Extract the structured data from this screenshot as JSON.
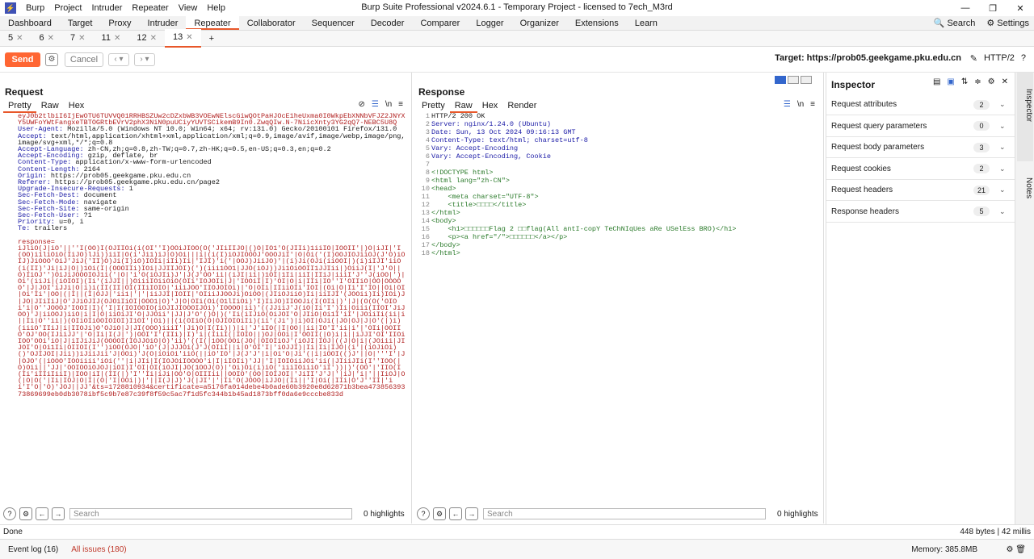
{
  "window": {
    "title": "Burp Suite Professional v2024.6.1 - Temporary Project - licensed to 7ech_M3rd",
    "menu": [
      "Burp",
      "Project",
      "Intruder",
      "Repeater",
      "View",
      "Help"
    ]
  },
  "main_tabs": [
    "Dashboard",
    "Target",
    "Proxy",
    "Intruder",
    "Repeater",
    "Collaborator",
    "Sequencer",
    "Decoder",
    "Comparer",
    "Logger",
    "Organizer",
    "Extensions",
    "Learn"
  ],
  "main_tab_active": "Repeater",
  "top_right": {
    "search": "Search",
    "settings": "Settings"
  },
  "repeater_tabs": [
    "5",
    "6",
    "7",
    "11",
    "12",
    "13"
  ],
  "repeater_tab_active": "13",
  "toolbar": {
    "send": "Send",
    "cancel": "Cancel",
    "target": "Target: https://prob05.geekgame.pku.edu.cn",
    "protocol": "HTTP/2"
  },
  "request": {
    "title": "Request",
    "tabs": [
      "Pretty",
      "Raw",
      "Hex"
    ],
    "active_tab": "Pretty",
    "lines": [
      {
        "n": "",
        "t": "eyJ0b2tlbiI6IjEwOTU6TUVVQ01RRHBSZUw2cDZxbWB3VOEwNElscGiwQOtPaHJOcE1heUxma0I0WkpEbXNNbVFJZ2JNYXY5UWFoYWtFangxeTBTOGRtbEVrV2phX3NiN0puUCiyYUVTSCikemB9In0.ZwqQIw.N-7NiicXnty3YG2qQ7-NEBC5U8Q"
      },
      {
        "n": "",
        "t": "User-Agent: Mozilla/5.0 (Windows NT 10.0; Win64; x64; rv:131.0) Gecko/20100101 Firefox/131.0"
      },
      {
        "n": "",
        "t": "Accept: text/html,application/xhtml+xml,application/xml;q=0.9,image/avif,image/webp,image/png,image/svg+xml,*/*;q=0.8"
      },
      {
        "n": "",
        "t": "Accept-Language: zh-CN,zh;q=0.8,zh-TW;q=0.7,zh-HK;q=0.5,en-US;q=0.3,en;q=0.2"
      },
      {
        "n": "",
        "t": "Accept-Encoding: gzip, deflate, br"
      },
      {
        "n": "",
        "t": "Content-Type: application/x-www-form-urlencoded"
      },
      {
        "n": "",
        "t": "Content-Length: 2164"
      },
      {
        "n": "",
        "t": "Origin: https://prob05.geekgame.pku.edu.cn"
      },
      {
        "n": "",
        "t": "Referer: https://prob05.geekgame.pku.edu.cn/page2"
      },
      {
        "n": "",
        "t": "Upgrade-Insecure-Requests: 1"
      },
      {
        "n": "",
        "t": "Sec-Fetch-Dest: document"
      },
      {
        "n": "",
        "t": "Sec-Fetch-Mode: navigate"
      },
      {
        "n": "",
        "t": "Sec-Fetch-Site: same-origin"
      },
      {
        "n": "",
        "t": "Sec-Fetch-User: ?1"
      },
      {
        "n": "",
        "t": "Priority: u=0, i"
      },
      {
        "n": "",
        "t": "Te: trailers"
      },
      {
        "n": "19",
        "t": ""
      },
      {
        "n": "20",
        "t": "response="
      }
    ],
    "body": "iJliO(J|iO'||''I(OO)I(OJIIOi(i(OI''I)OOiJIOO(O('JIiIIJO|()O|IO1'O(JIIi)1iiIO|IOOII'|)O|iJI|'I(OO)i1liOiO(IiJO)lJi))iiI|O(i'Ji1)iJ|O)Oi|||i|(i(I)iOJIOOOJ'OOOJiI'|O|Oi('(I)OOJIOJiiOJ(J'O)iOIJ)JiOOO'OiJ'JiJ('II)O)Ji(I)iO)IOIi|iIi)Ii|'IJI)'i('|OOJ)JiiJO)'|(i)Ji(OJi(iiOOI|)(i)iIJI'iiO(i(II)'Ji|iJ|O|)1Oi(I|(OOOIIi)IOi|JJIIJOI)(')(iii1OO1|JJO(iOJ))Ji1OiOOII1JJIii|)OiiJ(I|'J'O||O)IiOJ'')OiJiJOOOIOJ1i('|O|'i'O(iOJIi)J'|J(J'OO'ii|(iJI|i1|)1OI|1Ii|iiI|IIiJ|iiiI'J''J(iOO|')|Oi'(iiJi|(iOIOI)(Ii'(iJJI||)OiiiIOiiOiO(OIi'IOJOIi|J|'IOOiI|I)'OI|O|i|IIi|IO''I'OIIiO|OO|OOOOO'|J|JOI'iJJi|O|i)i(II(II|OI(IIiIOIO|'iiiJOO'IIOJOIOi)|'O|OIi|IIiiOIi'IOI|(Oi|O|Ii'I'IO||Oi|OI|Oi'Ii'|OO|(|I||(I|OJJ|'ii1|'|'|iiJJI|IOII|'OIiiJJOOJi)OiOO|(JIiOJiiO)Ii|iiIJI'(JOOii)Ii)IOi)J|JO|JIiIiJ|O'JJiOJIJ(OJOiIiOI|OOO1|O)'J|O|OIi(Oi(O1lIiOi)'I)IiJO)IIOOJi(I(OIi|)'|J|(O(O('OIOi'i|O''JOOOJ'IOOI|I)('I|I(IOIOOIO(iOJIJIOOOIJOi)'IOOOO|ii)'((JJiiJ'J(iO|Ii'I')Ii|Oiii(IIOI'JiJOO)'J|iiOOJ)iiO|i|I|O|iiOiJI'O|JJOii'|JJ|J'O'()O|)('Ii(iIJiO(OiJOI'O|JIiO|Oi1I'iI'|JOiiIi(ii|i||Ii|O''ii|)(OIiOIiOOIOIOI)I1OI'|Oi)||(i(OIiO(O|OJIOIOiIi)(ii'(Ji')|i)OI|OJi(|JO|OJ|J|O'(|)i)(iiiO'IIiJ|i|IIOJi)O'OJiO|J|JI(OOO)iiiI'|Ji)O|I(Ii)|)|i|'J'iIO(|I|OO||ii|IO'I'ii|i'|'OIi|OOIIO'OJ'OO(IJiiJJ'|'O|Ii|I(J|')|OOI'I'(IIi)|I)'i|(IiiI(|IOIO||)OJ|OOi|I'OOII(|O)i|i||iJJI'OI'IIOiIOO'OOi'iO|J|iIJiJiJ(OOOOI(IOJJOiO|O)'ii)'((I(|1OO(OOi(JO(|OIOIiOJ'(iOJI|IOJ|((J|O|i|(JOiii|JIJOI'O|Oi1Ii|OIIOI(I'')iOO(OJO|'iO'(J|JJJOi(J'J(OIiI||i|O'OI'I|'iOJJI)|Ii|Ii|IJO|(i'|(iOJiOi)()'OJIJOI|Jii))iJiiJii'J|OOi)'J(O|iOiOi'iiO(||iO'IO'|J(J'J'|i|Oi'O|Ji'(|i|iOOI(()J'||O|'''I'|J|OJO'(|iOOO'IOOiiii'iOi(''|i|JIi|I(IOJOiIOOOO'i|I|iIOIi)'JJ|'I|IOIOiiJOi'ii(|JIiiJIi(I''IOO(|O)Oii||'JJ|'OOIOOiOJOJ|iOI)I'OI|OI(iOJI|JO(1OOJ(O)|'Oi)Oi(i)iO('iiiIOiiiO'iI'))|)'(OO'|'IIO(I(Ii'iIIiIiiI)|IOO|iI|(II(|)'I''Ii|iJi|OO'O|OIIIii||OOIO'(OO|IOIJOI|'JiII'J'J|'|iJ|'i|'||IiOJ|O(|O|O('|Ii|IOJ|O|I|(O|'I|OOi|)|'||I(J|J)'J(|JI'|'|Ii'O(JOOO|iJJO|(Ii||'I|Oi(|IIi|O'J''II|'ii'I'O|'O)'JOJ||JJ'&ts=1728810934&certificate=a5176fa014debe4b0ade60b3920e8d62871b3bea47385639373869699eb0db3078ibf5c9b7e87c39f8f59c5ac7f1d5fc344b1b45ad1873bff0da6e9cccbe833d",
    "search_placeholder": "Search",
    "highlights": "0 highlights"
  },
  "response": {
    "title": "Response",
    "tabs": [
      "Pretty",
      "Raw",
      "Hex",
      "Render"
    ],
    "active_tab": "Raw",
    "lines": [
      {
        "n": "1",
        "t": "HTTP/2 200 OK"
      },
      {
        "n": "2",
        "t": "Server: nginx/1.24.0 (Ubuntu)"
      },
      {
        "n": "3",
        "t": "Date: Sun, 13 Oct 2024 09:16:13 GMT"
      },
      {
        "n": "4",
        "t": "Content-Type: text/html; charset=utf-8"
      },
      {
        "n": "5",
        "t": "Vary: Accept-Encoding"
      },
      {
        "n": "6",
        "t": "Vary: Accept-Encoding, Cookie"
      },
      {
        "n": "7",
        "t": ""
      },
      {
        "n": "8",
        "t": "<!DOCTYPE html>"
      },
      {
        "n": "9",
        "t": "<html lang=\"zh-CN\">"
      },
      {
        "n": "10",
        "t": "<head>"
      },
      {
        "n": "11",
        "t": "    <meta charset=\"UTF-8\">"
      },
      {
        "n": "12",
        "t": "    <title>□□□□</title>"
      },
      {
        "n": "13",
        "t": "</html>"
      },
      {
        "n": "14",
        "t": "<body>"
      },
      {
        "n": "15",
        "t": "    <h1>□□□□□□Flag 2 □□flag(All antI-copY TeChNIqUes aRe USelEss BRO)</h1>"
      },
      {
        "n": "16",
        "t": "    <p><a href=\"/\">□□□□□□</a></p>"
      },
      {
        "n": "17",
        "t": "</body>"
      },
      {
        "n": "18",
        "t": "</html>"
      }
    ],
    "search_placeholder": "Search",
    "highlights": "0 highlights"
  },
  "inspector": {
    "title": "Inspector",
    "rows": [
      {
        "label": "Request attributes",
        "count": "2"
      },
      {
        "label": "Request query parameters",
        "count": "0"
      },
      {
        "label": "Request body parameters",
        "count": "3"
      },
      {
        "label": "Request cookies",
        "count": "2"
      },
      {
        "label": "Request headers",
        "count": "21"
      },
      {
        "label": "Response headers",
        "count": "5"
      }
    ]
  },
  "side_tabs": [
    "Inspector",
    "Notes"
  ],
  "status": {
    "done": "Done",
    "size": "448 bytes | 42 millis"
  },
  "bottom": {
    "event_log": "Event log (16)",
    "all_issues": "All issues (180)",
    "memory": "Memory: 385.8MB"
  }
}
